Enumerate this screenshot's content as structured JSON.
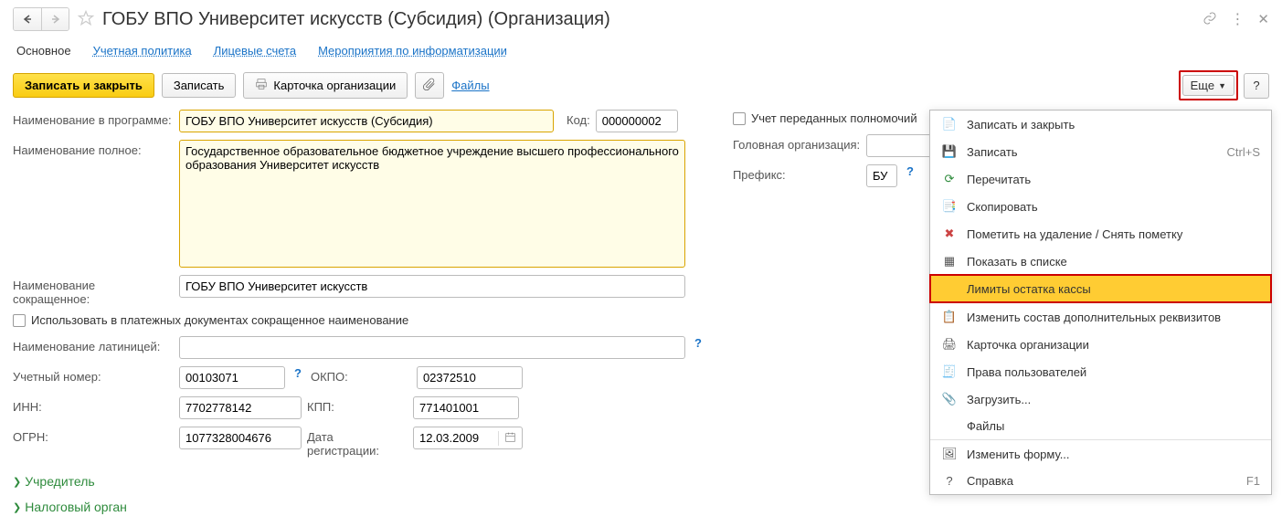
{
  "header": {
    "title": "ГОБУ ВПО Университет искусств (Субсидия) (Организация)"
  },
  "tabs": {
    "main": "Основное",
    "policy": "Учетная политика",
    "accounts": "Лицевые счета",
    "events": "Мероприятия по информатизации"
  },
  "toolbar": {
    "save_close": "Записать и закрыть",
    "save": "Записать",
    "card": "Карточка организации",
    "files": "Файлы",
    "more": "Еще"
  },
  "labels": {
    "name_program": "Наименование в программе:",
    "code": "Код:",
    "name_full": "Наименование полное:",
    "name_short": "Наименование сокращенное:",
    "use_short": "Использовать в платежных документах сокращенное наименование",
    "name_latin": "Наименование латиницей:",
    "acc_number": "Учетный номер:",
    "okpo": "ОКПО:",
    "inn": "ИНН:",
    "kpp": "КПП:",
    "ogrn": "ОГРН:",
    "reg_date": "Дата регистрации:",
    "delegated": "Учет переданных полномочий",
    "head_org": "Головная организация:",
    "prefix": "Префикс:"
  },
  "values": {
    "name_program": "ГОБУ ВПО Университет искусств (Субсидия)",
    "code": "000000002",
    "name_full": "Государственное образовательное бюджетное учреждение высшего профессионального образования Университет искусств",
    "name_short": "ГОБУ ВПО Университет искусств",
    "name_latin": "",
    "acc_number": "00103071",
    "okpo": "02372510",
    "inn": "7702778142",
    "kpp": "771401001",
    "ogrn": "1077328004676",
    "reg_date": "12.03.2009",
    "head_org": "",
    "prefix": "БУ"
  },
  "expanders": {
    "founder": "Учредитель",
    "tax": "Налоговый орган"
  },
  "menu": {
    "save_close": "Записать и закрыть",
    "save": "Записать",
    "save_shortcut": "Ctrl+S",
    "reread": "Перечитать",
    "copy": "Скопировать",
    "mark_delete": "Пометить на удаление / Снять пометку",
    "show_list": "Показать в списке",
    "cash_limits": "Лимиты остатка кассы",
    "change_props": "Изменить состав дополнительных реквизитов",
    "org_card": "Карточка организации",
    "user_rights": "Права пользователей",
    "load": "Загрузить...",
    "files": "Файлы",
    "change_form": "Изменить форму...",
    "help": "Справка",
    "help_shortcut": "F1"
  }
}
